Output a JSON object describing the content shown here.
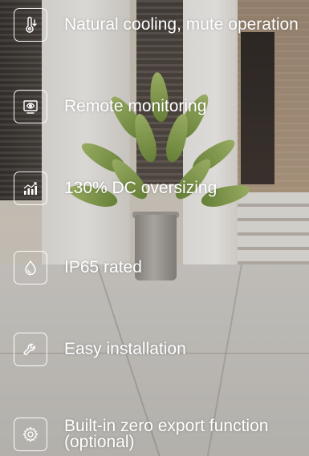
{
  "features": [
    {
      "label": "Natural cooling, mute operation",
      "icon": "thermometer-icon"
    },
    {
      "label": "Remote monitoring",
      "icon": "monitor-icon"
    },
    {
      "label": "130% DC oversizing",
      "icon": "growth-chart-icon"
    },
    {
      "label": "IP65 rated",
      "icon": "water-drop-icon"
    },
    {
      "label": "Easy installation",
      "icon": "wrench-icon"
    },
    {
      "label": "Built-in zero export function (optional)",
      "icon": "gear-icon"
    }
  ]
}
